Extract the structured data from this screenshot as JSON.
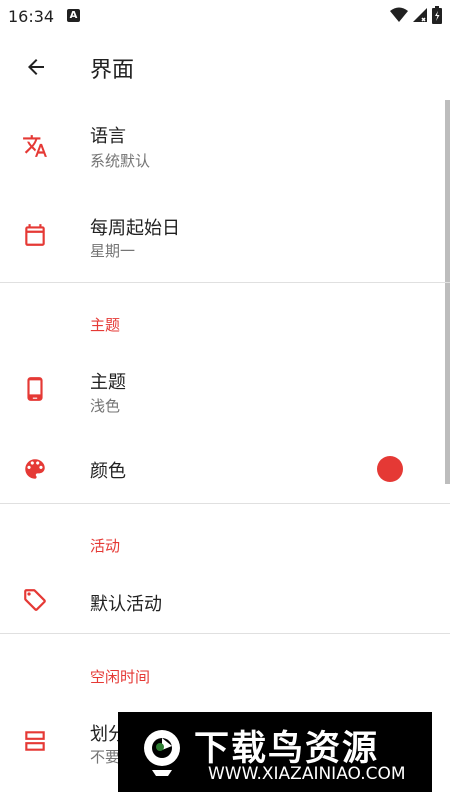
{
  "status_bar": {
    "time": "16:34",
    "notification_letter": "A"
  },
  "app_bar": {
    "title": "界面",
    "back_icon": "arrow-back-icon"
  },
  "general": {
    "language": {
      "title": "语言",
      "subtitle": "系统默认",
      "icon": "translate-icon"
    },
    "first_day": {
      "title": "每周起始日",
      "subtitle": "星期一",
      "icon": "calendar-icon"
    }
  },
  "theme_section": {
    "header": "主题",
    "theme": {
      "title": "主题",
      "subtitle": "浅色",
      "icon": "phone-icon"
    },
    "color": {
      "title": "颜色",
      "icon": "palette-icon",
      "swatch_color": "#e53935"
    }
  },
  "activity_section": {
    "header": "活动",
    "default_activity": {
      "title": "默认活动",
      "icon": "tag-icon"
    }
  },
  "idle_section": {
    "header": "空闲时间",
    "split": {
      "title": "划分",
      "subtitle": "不要",
      "icon": "split-view-icon"
    }
  },
  "watermark": {
    "title": "下载鸟资源",
    "url": "WWW.XIAZAINIAO.COM"
  },
  "colors": {
    "accent": "#e53935",
    "text_primary": "#212121",
    "text_secondary": "#757575",
    "divider": "#e0e0e0"
  }
}
